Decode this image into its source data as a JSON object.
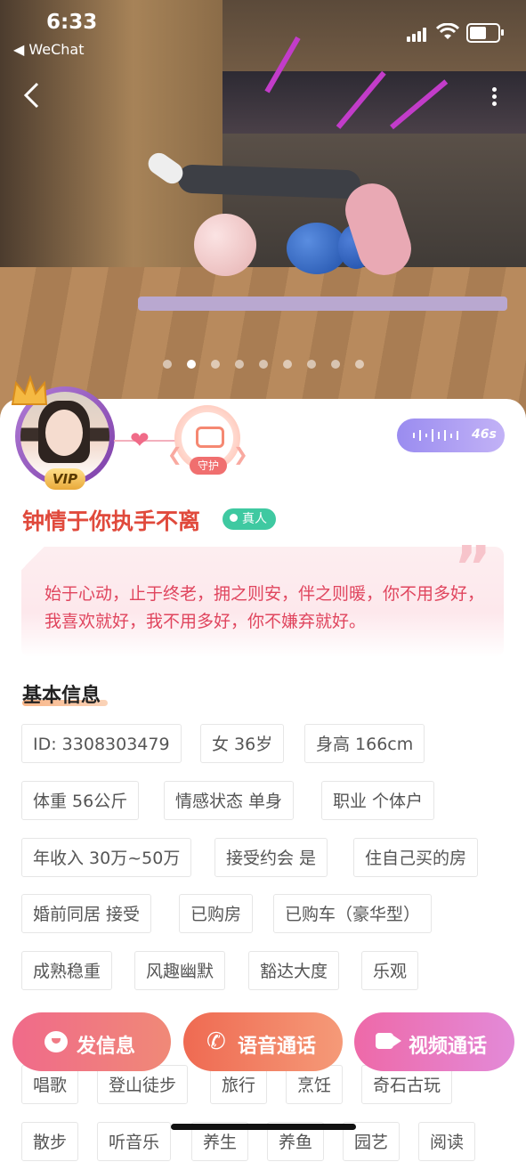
{
  "status_bar": {
    "time": "6:33",
    "back_app": "◀ WeChat"
  },
  "carousel": {
    "total": 9,
    "active_index": 1
  },
  "profile": {
    "vip_badge": "VIP",
    "guard_label": "守护",
    "voice_duration": "46s",
    "name": "钟情于你执手不离",
    "verified_label": "真人",
    "quote": "始于心动，止于终老，拥之则安，伴之则暖，你不用多好，我喜欢就好，我不用多好，你不嫌弃就好。"
  },
  "basic_info": {
    "title": "基本信息",
    "tags": [
      "ID: 3308303479",
      "女 36岁",
      "身高 166cm",
      "体重 56公斤",
      "情感状态 单身",
      "职业 个体户",
      "年收入 30万~50万",
      "接受约会 是",
      "住自己买的房",
      "婚前同居 接受",
      "已购房",
      "已购车（豪华型）",
      "成熟稳重",
      "风趣幽默",
      "豁达大度",
      "乐观",
      "唱歌",
      "登山徒步",
      "旅行",
      "烹饪",
      "奇石古玩",
      "散步",
      "听音乐",
      "养生",
      "养鱼",
      "园艺",
      "阅读"
    ]
  },
  "actions": {
    "message": "发信息",
    "voice_call": "语音通话",
    "video_call": "视频通话"
  },
  "colors": {
    "name": "#e04a3c",
    "quote": "#e0455e",
    "verified": "#3fc9a1"
  }
}
